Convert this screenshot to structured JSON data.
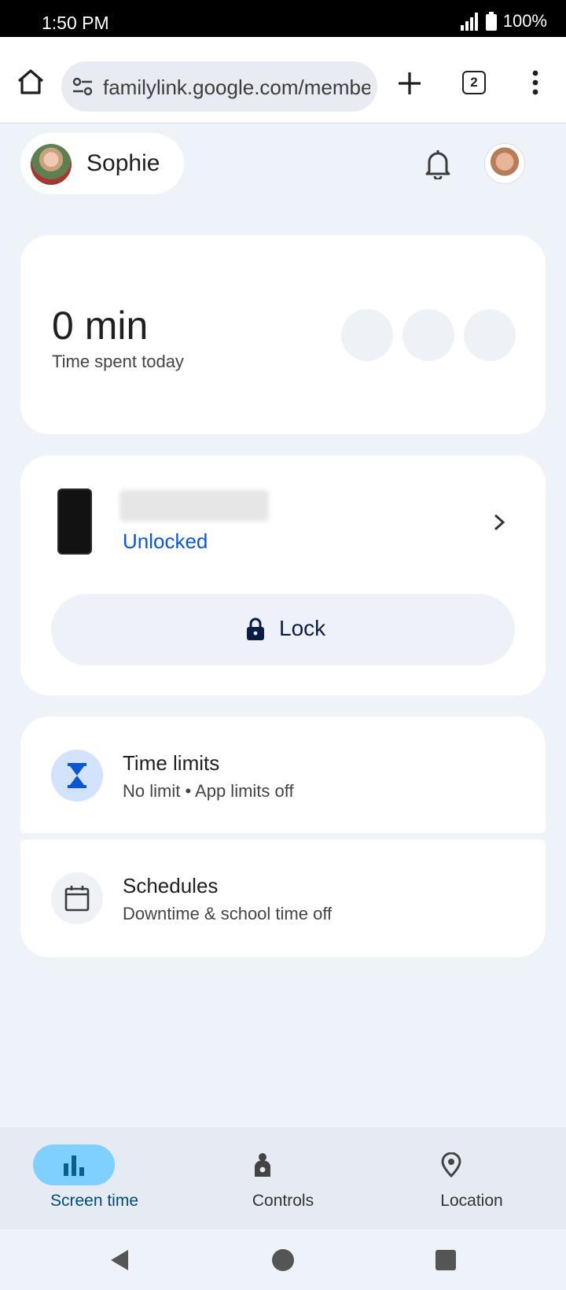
{
  "status_bar": {
    "time": "1:50 PM",
    "battery": "100%"
  },
  "browser": {
    "url": "familylink.google.com/members",
    "tab_count": "2"
  },
  "header": {
    "child_name": "Sophie"
  },
  "time_card": {
    "value": "0 min",
    "label": "Time spent today"
  },
  "device_card": {
    "status": "Unlocked",
    "lock_label": "Lock"
  },
  "limits": {
    "title": "Time limits",
    "subtitle": "No limit • App limits off"
  },
  "schedules": {
    "title": "Schedules",
    "subtitle": "Downtime & school time off"
  },
  "bottom_nav": {
    "items": [
      {
        "label": "Screen time",
        "icon": "bar-chart-icon",
        "active": true
      },
      {
        "label": "Controls",
        "icon": "controls-icon",
        "active": false
      },
      {
        "label": "Location",
        "icon": "location-pin-icon",
        "active": false
      }
    ]
  },
  "colors": {
    "accent": "#0b57d0",
    "active_nav": "#7fcfff",
    "background": "#eef2f9"
  }
}
